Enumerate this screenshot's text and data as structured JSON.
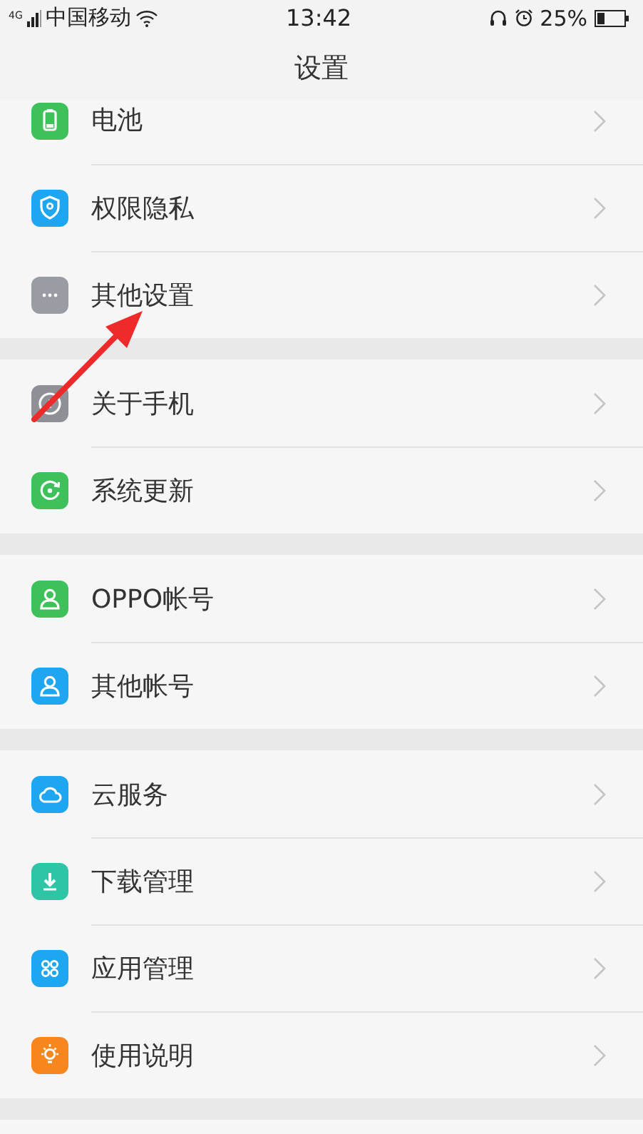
{
  "status_bar": {
    "network": "4G",
    "carrier": "中国移动",
    "time": "13:42",
    "battery_percent": "25%"
  },
  "header": {
    "title": "设置"
  },
  "groups": [
    {
      "items": [
        {
          "label": "电池",
          "kind": "battery",
          "color": "#3ec05a"
        },
        {
          "label": "权限隐私",
          "kind": "shield",
          "color": "#1ea7f0"
        },
        {
          "label": "其他设置",
          "kind": "dots",
          "color": "#9a9ca3"
        }
      ]
    },
    {
      "items": [
        {
          "label": "关于手机",
          "kind": "info",
          "color": "#8e9096"
        },
        {
          "label": "系统更新",
          "kind": "update",
          "color": "#3ec05a"
        }
      ]
    },
    {
      "items": [
        {
          "label": "OPPO帐号",
          "kind": "person",
          "color": "#3ec05a"
        },
        {
          "label": "其他帐号",
          "kind": "person",
          "color": "#1ea7f0"
        }
      ]
    },
    {
      "items": [
        {
          "label": "云服务",
          "kind": "cloud",
          "color": "#1ea7f0"
        },
        {
          "label": "下载管理",
          "kind": "download",
          "color": "#2ec4a6"
        },
        {
          "label": "应用管理",
          "kind": "apps",
          "color": "#1ea7f0"
        },
        {
          "label": "使用说明",
          "kind": "bulb",
          "color": "#f7861c"
        }
      ]
    }
  ]
}
